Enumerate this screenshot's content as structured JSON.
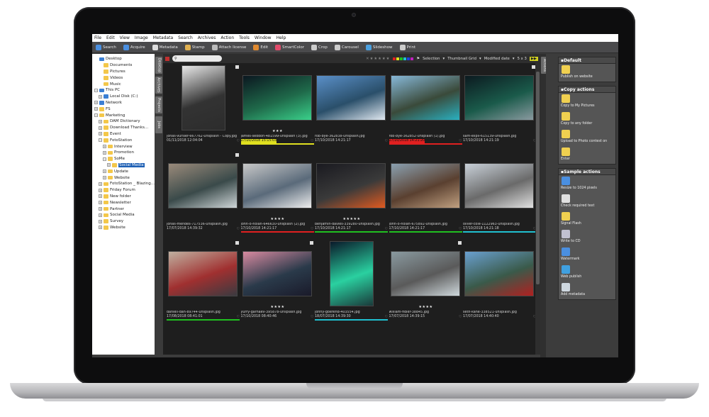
{
  "menu": [
    "File",
    "Edit",
    "View",
    "Image",
    "Metadata",
    "Search",
    "Archives",
    "Action",
    "Tools",
    "Window",
    "Help"
  ],
  "toolbar": [
    {
      "label": "Search",
      "color": "#4a8fe0"
    },
    {
      "label": "Acquire",
      "color": "#4a8fe0"
    },
    {
      "label": "Metadata",
      "color": "#ddd"
    },
    {
      "label": "Stamp",
      "color": "#e0b050"
    },
    {
      "label": "Attach license",
      "color": "#bbb"
    },
    {
      "label": "Edit",
      "color": "#e08a30"
    },
    {
      "label": "SmartColor",
      "color": "#e04a6a"
    },
    {
      "label": "Crop",
      "color": "#ccc"
    },
    {
      "label": "Carousel",
      "color": "#ccc"
    },
    {
      "label": "Slideshow",
      "color": "#4aa0e0"
    },
    {
      "label": "Print",
      "color": "#ccc"
    }
  ],
  "tree": [
    {
      "label": "Desktop",
      "depth": 0,
      "icon": "blue",
      "exp": ""
    },
    {
      "label": "Documents",
      "depth": 1,
      "icon": "yellow",
      "exp": ""
    },
    {
      "label": "Pictures",
      "depth": 1,
      "icon": "yellow",
      "exp": ""
    },
    {
      "label": "Videos",
      "depth": 1,
      "icon": "yellow",
      "exp": ""
    },
    {
      "label": "Music",
      "depth": 1,
      "icon": "yellow",
      "exp": ""
    },
    {
      "label": "This PC",
      "depth": 0,
      "icon": "blue",
      "exp": "−"
    },
    {
      "label": "Local Disk (C:)",
      "depth": 1,
      "icon": "blue",
      "exp": "+"
    },
    {
      "label": "Network",
      "depth": 0,
      "icon": "blue",
      "exp": "+"
    },
    {
      "label": "FS",
      "depth": 0,
      "icon": "yellow",
      "exp": "+"
    },
    {
      "label": "Marketing",
      "depth": 0,
      "icon": "yellow",
      "exp": "−"
    },
    {
      "label": "DAM Dictionary",
      "depth": 1,
      "icon": "yellow",
      "exp": "+"
    },
    {
      "label": "Download Thanks...",
      "depth": 1,
      "icon": "yellow",
      "exp": "+"
    },
    {
      "label": "Event",
      "depth": 1,
      "icon": "yellow",
      "exp": "+"
    },
    {
      "label": "FotoStation",
      "depth": 1,
      "icon": "yellow",
      "exp": "−"
    },
    {
      "label": "Interview",
      "depth": 2,
      "icon": "yellow",
      "exp": "+"
    },
    {
      "label": "Promotion",
      "depth": 2,
      "icon": "yellow",
      "exp": "+"
    },
    {
      "label": "SoMe",
      "depth": 2,
      "icon": "yellow",
      "exp": "−"
    },
    {
      "label": "Social Media",
      "depth": 3,
      "icon": "yellow",
      "exp": "+",
      "selected": true
    },
    {
      "label": "Update",
      "depth": 2,
      "icon": "yellow",
      "exp": "+"
    },
    {
      "label": "Website",
      "depth": 2,
      "icon": "yellow",
      "exp": "+"
    },
    {
      "label": "FotoStation _ Blazing...",
      "depth": 1,
      "icon": "yellow",
      "exp": "+"
    },
    {
      "label": "Friday Forum",
      "depth": 1,
      "icon": "yellow",
      "exp": "+"
    },
    {
      "label": "New folder",
      "depth": 1,
      "icon": "yellow",
      "exp": "+"
    },
    {
      "label": "Newsletter",
      "depth": 1,
      "icon": "yellow",
      "exp": "+"
    },
    {
      "label": "Partner",
      "depth": 1,
      "icon": "yellow",
      "exp": "+"
    },
    {
      "label": "Social Media",
      "depth": 1,
      "icon": "yellow",
      "exp": "+"
    },
    {
      "label": "Survey",
      "depth": 1,
      "icon": "yellow",
      "exp": "+"
    },
    {
      "label": "Website",
      "depth": 1,
      "icon": "yellow",
      "exp": "+"
    }
  ],
  "vtabs": [
    "Desktop",
    "Archives",
    "Projects",
    "Jobs"
  ],
  "filterbar": {
    "selection": "Selection",
    "view": "Thumbnail Grid",
    "sort": "Modified date",
    "grid": "5 x 3"
  },
  "thumbs": [
    {
      "name": "jonas-vursler-667762-unsplash - Copy.jpg",
      "date": "01/11/2018 12:04:04",
      "stars": "",
      "bar": "",
      "palette": [
        "#e8e8e8",
        "#333",
        "#2c2c2c"
      ],
      "flag": true,
      "orient": "portrait"
    },
    {
      "name": "james-seddon-481599-unsplash (3).jpg",
      "date": "17/10/2018 15:15:03",
      "stars": "★★★",
      "bar": "#e0e020",
      "palette": [
        "#0b1720",
        "#1f6a4a",
        "#3ad08a"
      ],
      "flag": false,
      "orient": "land",
      "highlight": true
    },
    {
      "name": "rob-bye-362838-unsplash.jpg",
      "date": "17/10/2018 14:21:17",
      "stars": "",
      "bar": "",
      "palette": [
        "#5a8fc8",
        "#2a4f6a",
        "#e0e8f0"
      ],
      "flag": false,
      "orient": "land"
    },
    {
      "name": "rob-bye-362852-unsplash (1).jpg",
      "date": "17/10/2018 14:21:20",
      "stars": "",
      "bar": "#e02020",
      "palette": [
        "#87b8d8",
        "#3a4a3a",
        "#2ab0c0"
      ],
      "flag": false,
      "orient": "land",
      "highlight": true
    },
    {
      "name": "sam-elipil-615139-unsplash.jpg",
      "date": "17/10/2018 14:21:19",
      "stars": "",
      "bar": "",
      "palette": [
        "#0c1a20",
        "#1a5a4a",
        "#8a9aa0"
      ],
      "flag": true,
      "orient": "land"
    },
    {
      "name": "jonas-mendes-717536-unsplash.jpg",
      "date": "17/07/2018 14:39:32",
      "stars": "",
      "bar": "",
      "palette": [
        "#9a8a7a",
        "#3a4a4a",
        "#cfd6d8"
      ],
      "flag": true,
      "orient": "land"
    },
    {
      "name": "john-o-nolan-646630-unsplash (2).jpg",
      "date": "17/10/2018 14:21:17",
      "stars": "★★★★",
      "bar": "#e02020",
      "palette": [
        "#c8c8c8",
        "#5a6a7a",
        "#eee"
      ],
      "flag": false,
      "orient": "land"
    },
    {
      "name": "benjamin-davies-339280-unsplash.jpg",
      "date": "17/10/2018 14:21:17",
      "stars": "★★★★★",
      "bar": "#20c020",
      "palette": [
        "#1a1a20",
        "#3a3a3a",
        "#e05a20"
      ],
      "flag": false,
      "orient": "land"
    },
    {
      "name": "john-o-nolan-675892-unsplash.jpg",
      "date": "17/10/2018 14:21:17",
      "stars": "",
      "bar": "#20c020",
      "palette": [
        "#8aa0b0",
        "#5a4030",
        "#c0a080"
      ],
      "flag": false,
      "orient": "land"
    },
    {
      "name": "oliver-cole-1122963-unsplash.jpg",
      "date": "17/10/2018 14:21:18",
      "stars": "",
      "bar": "#20c0d0",
      "palette": [
        "#c8d0d8",
        "#6a6a6a",
        "#e0e0e0"
      ],
      "flag": false,
      "orient": "land"
    },
    {
      "name": "danieli-dan-89744-unsplash.jpg",
      "date": "17/08/2018 08:41:01",
      "stars": "",
      "bar": "#20c020",
      "palette": [
        "#c0b0a0",
        "#a03030",
        "#3a3a40"
      ],
      "flag": true,
      "orient": "land"
    },
    {
      "name": "yurry-garnaev-395878-unsplash.jpg",
      "date": "17/10/2018 08:40:46",
      "stars": "★★★★",
      "bar": "",
      "palette": [
        "#d88aa0",
        "#2a3a4a",
        "#1a1a2a"
      ],
      "flag": true,
      "orient": "land"
    },
    {
      "name": "johny-goerend-403554.jpg",
      "date": "18/07/2018 14:39:30",
      "stars": "",
      "bar": "#20c0d0",
      "palette": [
        "#0a1a2a",
        "#2ad0a0",
        "#1a3a3a"
      ],
      "flag": false,
      "orient": "portrait"
    },
    {
      "name": "william-fidler-38845.jpg",
      "date": "17/07/2018 14:39:15",
      "stars": "★★★★",
      "bar": "",
      "palette": [
        "#8a9aa0",
        "#5a5a5a",
        "#cfd8dc"
      ],
      "flag": true,
      "orient": "land"
    },
    {
      "name": "seth-kane-338521-unsplash.jpg",
      "date": "17/07/2018 14:40:40",
      "stars": "",
      "bar": "",
      "palette": [
        "#6aa0d0",
        "#3a5a4a",
        "#b02020"
      ],
      "flag": false,
      "orient": "land"
    }
  ],
  "right_panel": {
    "tab": "Actions",
    "sections": [
      {
        "title": "Default",
        "actions": [
          {
            "label": "Publish on website",
            "color": "#f0d050"
          }
        ]
      },
      {
        "title": "Copy actions",
        "actions": [
          {
            "label": "Copy to My Pictures",
            "color": "#f0d050"
          },
          {
            "label": "Copy to any folder",
            "color": "#f0d050"
          },
          {
            "label": "Upload to Photo contest on",
            "color": "#f0d050"
          },
          {
            "label": "Enter",
            "color": "#f0d050"
          }
        ]
      },
      {
        "title": "Sample actions",
        "actions": [
          {
            "label": "Resize to 1024 pixels",
            "color": "#4a8fe0"
          },
          {
            "label": "Check required text",
            "color": "#e0e0e0"
          },
          {
            "label": "Signal Flash",
            "color": "#f0d050"
          },
          {
            "label": "Write to CD",
            "color": "#c0c0d0"
          },
          {
            "label": "Watermark",
            "color": "#4a8fe0"
          },
          {
            "label": "Web publish",
            "color": "#40a0e0"
          },
          {
            "label": "Add metadata",
            "color": "#cfd8e0"
          }
        ]
      }
    ]
  }
}
